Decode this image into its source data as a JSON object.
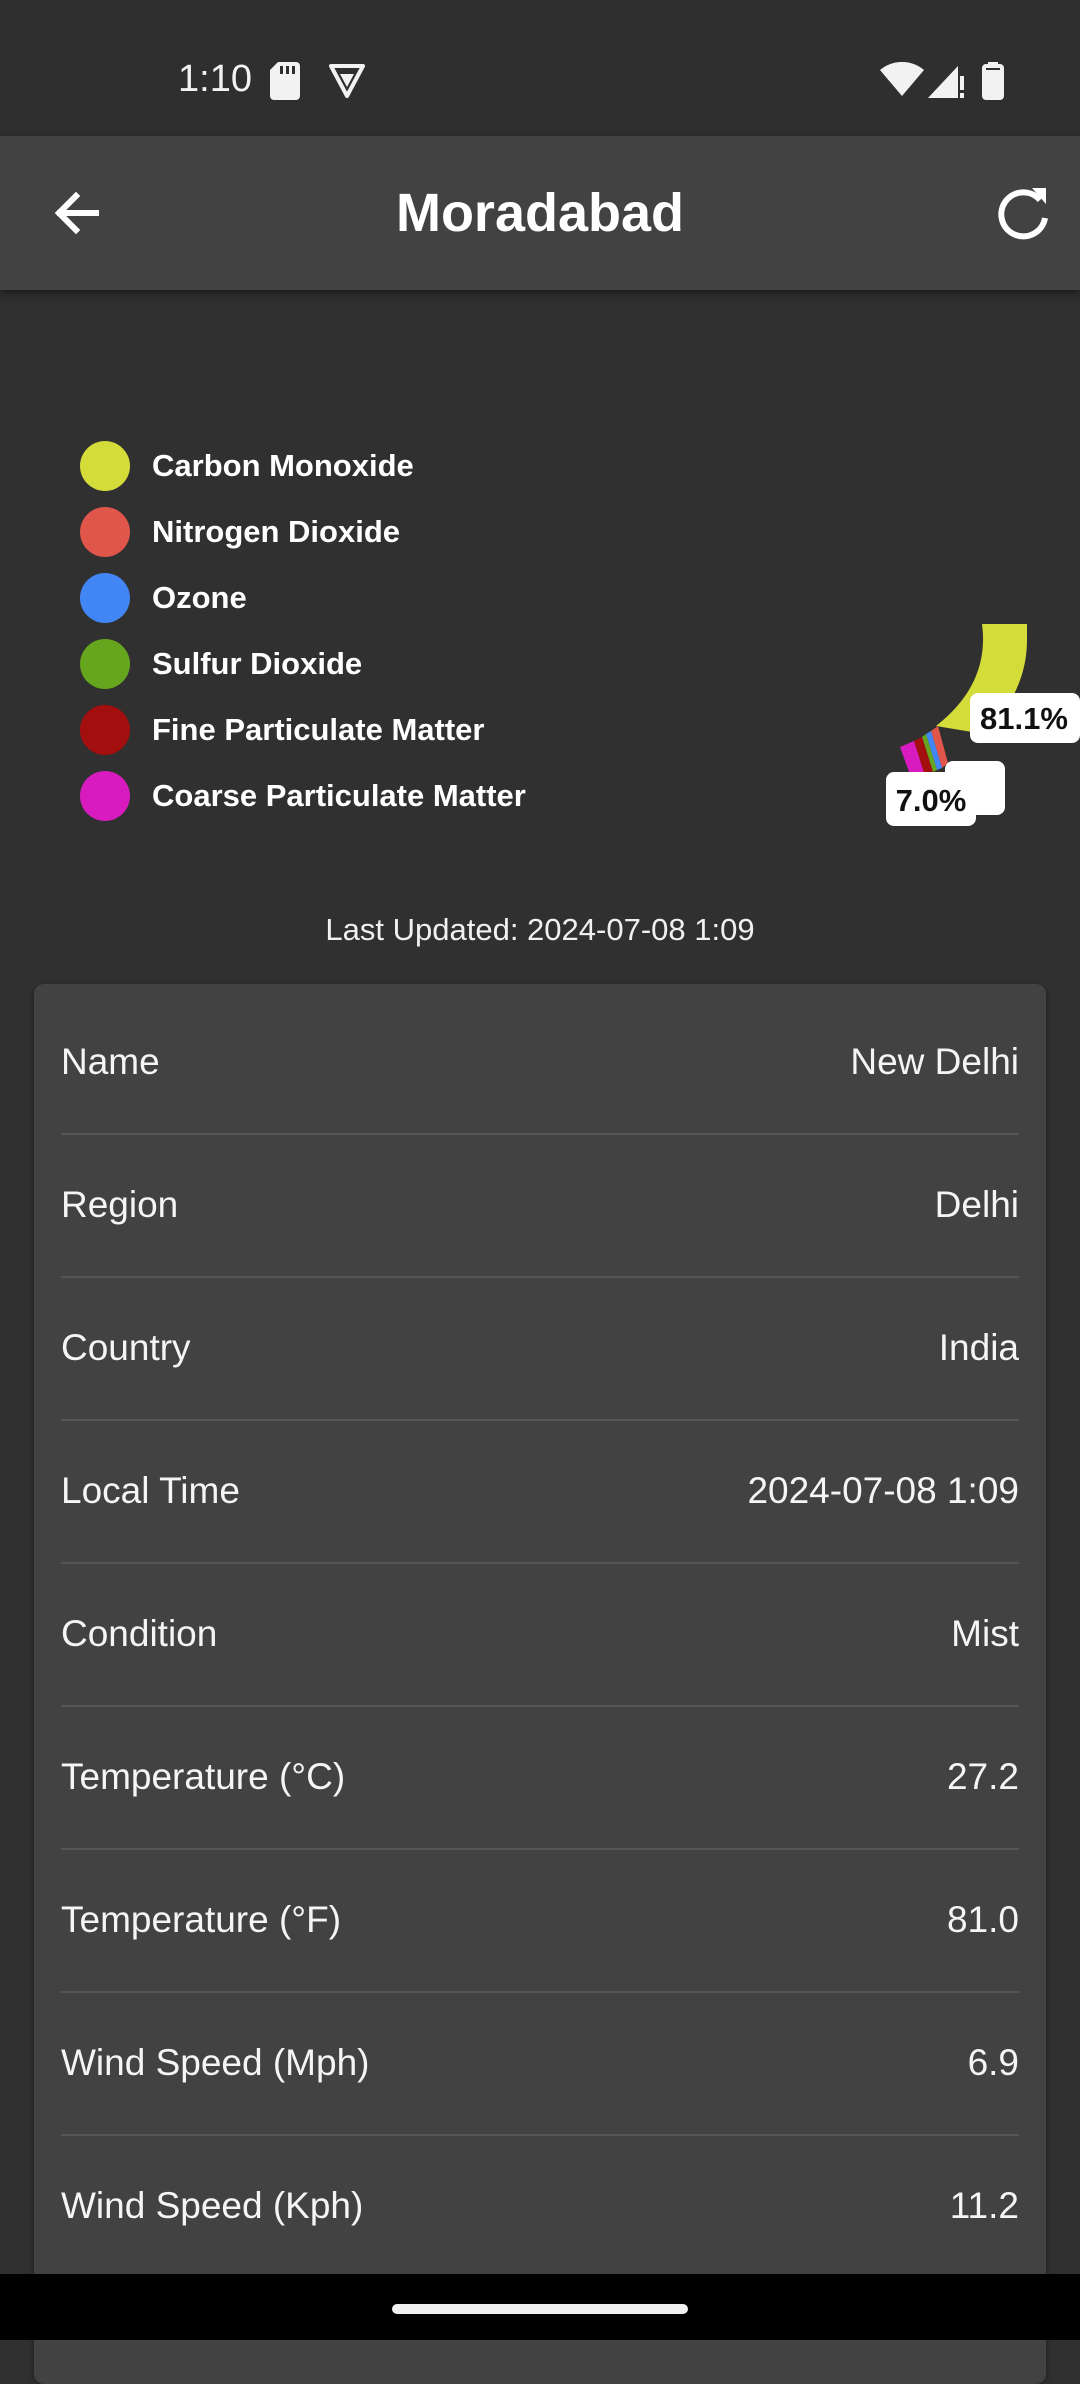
{
  "status_bar": {
    "time": "1:10",
    "icons": [
      "sd-card-icon",
      "vpn-icon",
      "wifi-icon",
      "signal-icon",
      "battery-icon"
    ]
  },
  "app_bar": {
    "title": "Moradabad",
    "back_icon": "arrow-back-icon",
    "refresh_icon": "refresh-icon"
  },
  "legend": [
    {
      "label": "Carbon Monoxide",
      "color": "#d4dc3a"
    },
    {
      "label": "Nitrogen Dioxide",
      "color": "#e0564a"
    },
    {
      "label": "Ozone",
      "color": "#4285f4"
    },
    {
      "label": "Sulfur Dioxide",
      "color": "#66a61e"
    },
    {
      "label": "Fine Particulate Matter",
      "color": "#a30e0e"
    },
    {
      "label": "Coarse Particulate Matter",
      "color": "#d81bbf"
    }
  ],
  "chart_data": {
    "type": "pie",
    "labels": [
      "Carbon Monoxide",
      "Nitrogen Dioxide",
      "Ozone",
      "Sulfur Dioxide",
      "Fine Particulate Matter",
      "Coarse Particulate Matter"
    ],
    "data_labels": [
      "81.1%",
      "7.0%"
    ]
  },
  "last_updated": "Last Updated: 2024-07-08 1:09",
  "details": [
    {
      "label": "Name",
      "value": "New Delhi"
    },
    {
      "label": "Region",
      "value": "Delhi"
    },
    {
      "label": "Country",
      "value": "India"
    },
    {
      "label": "Local Time",
      "value": "2024-07-08 1:09"
    },
    {
      "label": "Condition",
      "value": "Mist"
    },
    {
      "label": "Temperature (°C)",
      "value": "27.2"
    },
    {
      "label": "Temperature (°F)",
      "value": "81.0"
    },
    {
      "label": "Wind Speed (Mph)",
      "value": "6.9"
    },
    {
      "label": "Wind Speed (Kph)",
      "value": "11.2"
    }
  ]
}
